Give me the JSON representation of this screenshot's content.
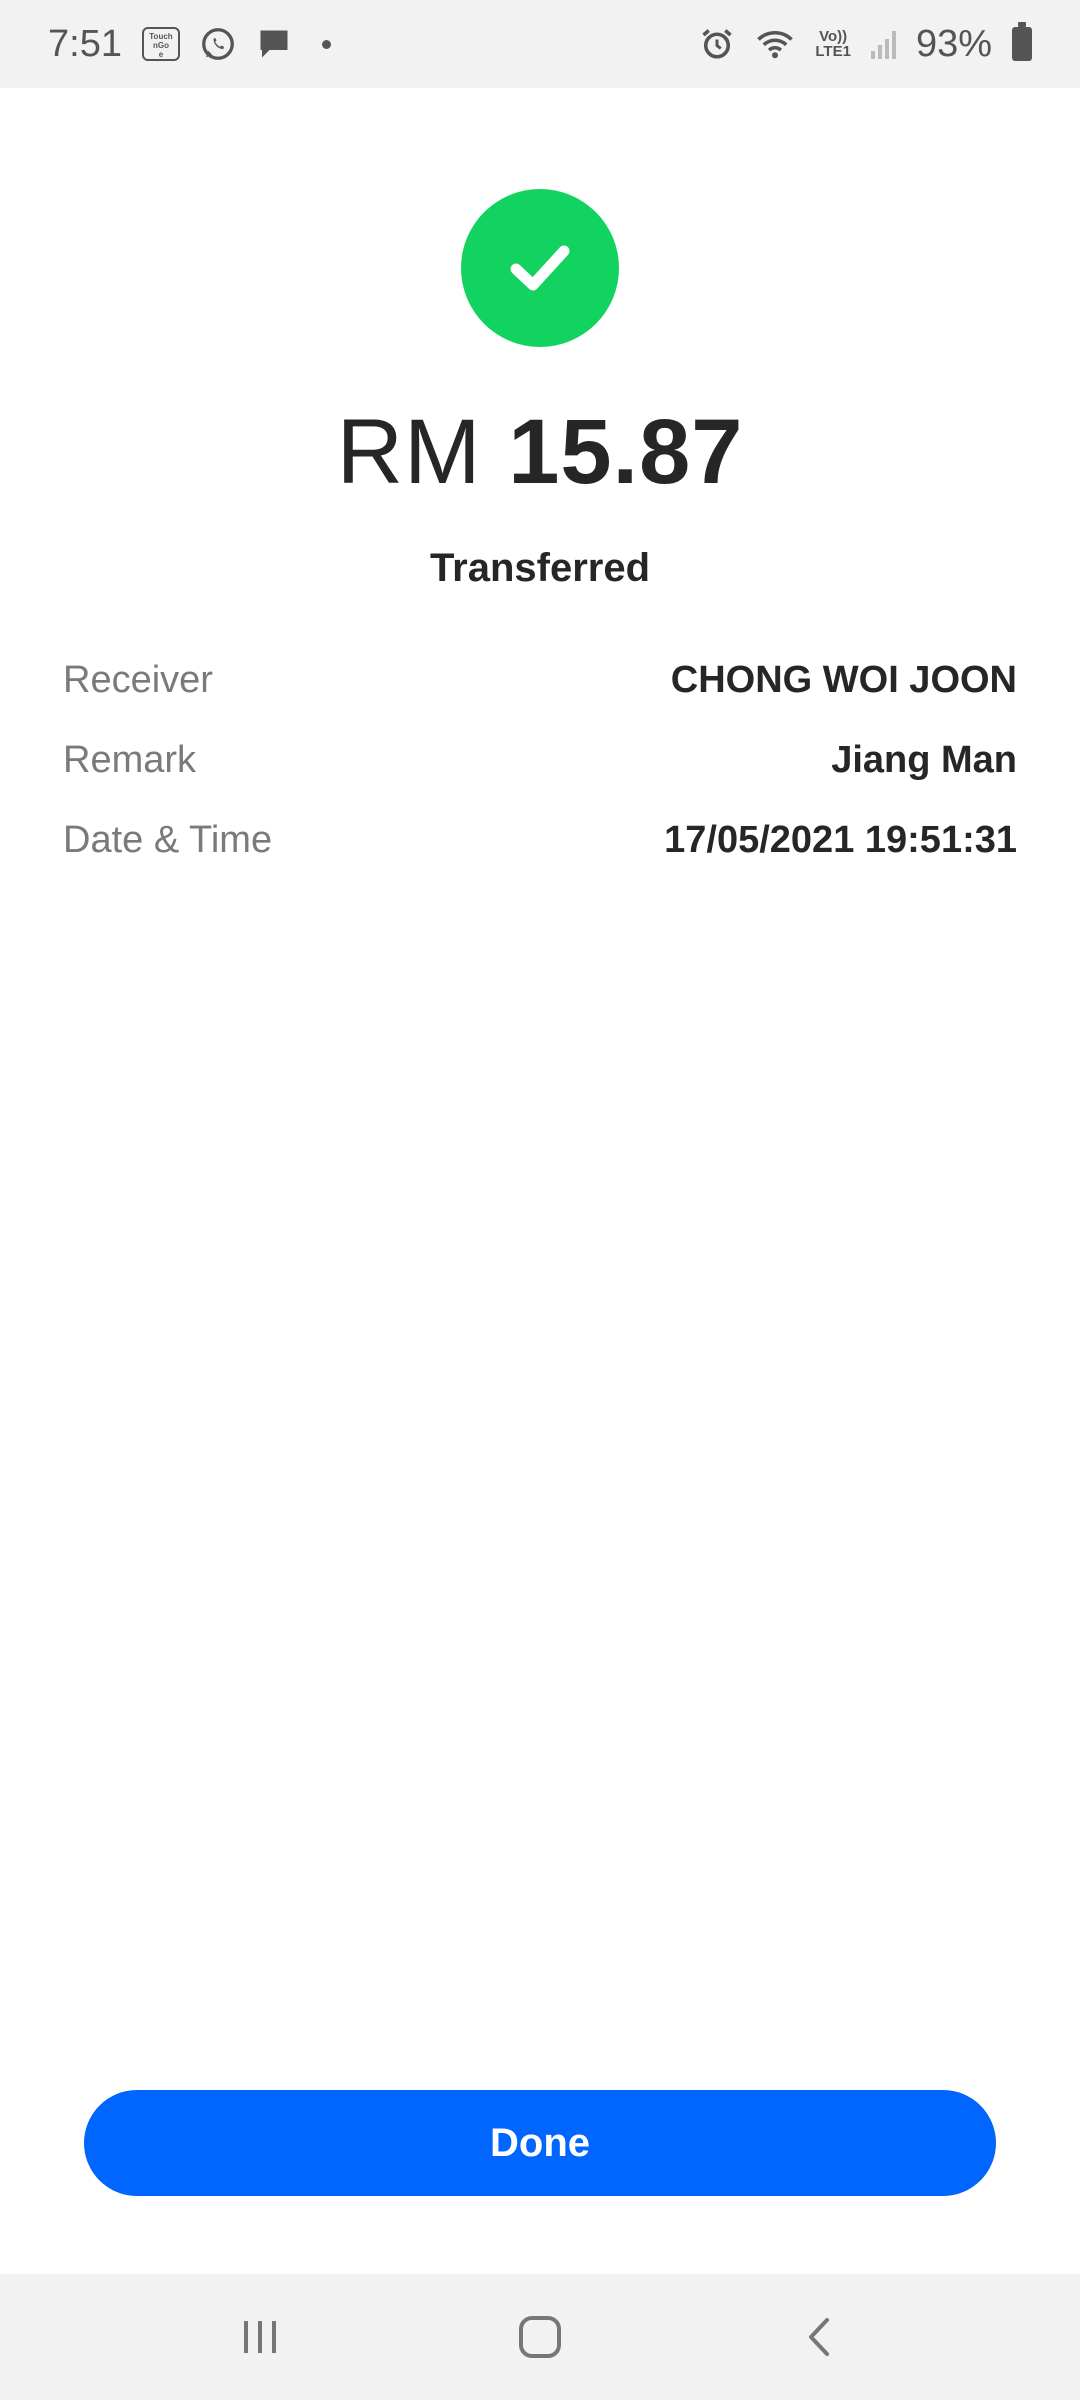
{
  "status_bar": {
    "time": "7:51",
    "tng_badge": "Touch’nGo eWallet",
    "battery": "93%",
    "network": "Vo))\nLTE1",
    "icons": [
      "touch-n-go-icon",
      "whatsapp-icon",
      "message-icon",
      "dot-icon",
      "alarm-icon",
      "wifi-icon",
      "volte-icon",
      "signal-icon",
      "battery-icon"
    ]
  },
  "result": {
    "icon": "check-icon",
    "color": "#12d35f",
    "currency": "RM",
    "amount": "15.87",
    "status": "Transferred"
  },
  "details": [
    {
      "label": "Receiver",
      "value": "CHONG WOI JOON"
    },
    {
      "label": "Remark",
      "value": "Jiang Man"
    },
    {
      "label": "Date & Time",
      "value": "17/05/2021 19:51:31"
    }
  ],
  "actions": {
    "done_label": "Done",
    "color": "#0066ff"
  },
  "nav_bar": {
    "icons": [
      "recent-apps-icon",
      "home-icon",
      "back-icon"
    ]
  }
}
